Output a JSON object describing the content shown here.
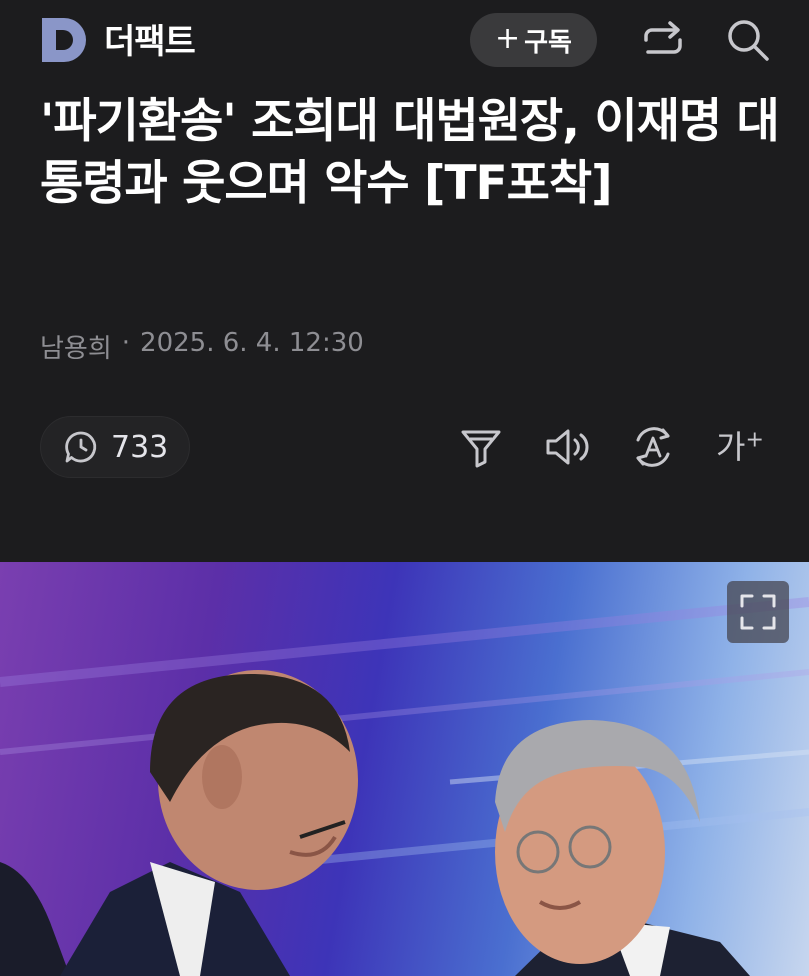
{
  "header": {
    "logo_letter": "D",
    "brand_name": "더팩트",
    "subscribe_plus": "+",
    "subscribe_label": "구독",
    "share_icon": "share-icon",
    "search_icon": "search-icon"
  },
  "article": {
    "title": "'파기환송' 조희대 대법원장, 이재명 대통령과 웃으며 악수 [TF포착]",
    "author": "남용희",
    "separator": "·",
    "datetime": "2025. 6. 4. 12:30"
  },
  "toolbar": {
    "comment_count": "733",
    "comment_icon": "comment-icon",
    "filter_icon": "filter-icon",
    "audio_icon": "speaker-icon",
    "translate_icon": "translate-icon",
    "fontsize_label": "가",
    "fontsize_plus": "+"
  },
  "colors": {
    "background": "#1c1c1e",
    "meta_text": "#8e8e93",
    "button_bg": "#3a3a3c",
    "logo_color": "#8a96c8"
  }
}
